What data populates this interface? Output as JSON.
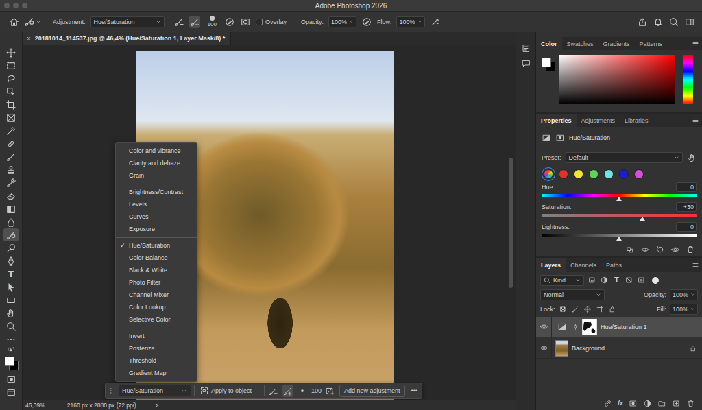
{
  "window": {
    "title": "Adobe Photoshop 2026"
  },
  "options_bar": {
    "adjustment_label": "Adjustment:",
    "adjustment": "Hue/Saturation",
    "brush_modes": [
      {
        "kind": "subtract",
        "selected": false
      },
      {
        "kind": "add",
        "selected": true
      }
    ],
    "brush_size": "100",
    "overlay": {
      "label": "Overlay",
      "checked": false
    },
    "opacity_label": "Opacity:",
    "opacity": "100%",
    "flow_label": "Flow:",
    "flow": "100%"
  },
  "document": {
    "tab": "20181014_114537.jpg @ 46,4% (Hue/Saturation 1, Layer Mask/8) *",
    "close": "×"
  },
  "tools": [
    {
      "kind": "move",
      "selected": false
    },
    {
      "kind": "marquee",
      "selected": false
    },
    {
      "kind": "lasso",
      "selected": false
    },
    {
      "kind": "object-select",
      "selected": false
    },
    {
      "kind": "crop",
      "selected": false
    },
    {
      "kind": "frame",
      "selected": false
    },
    {
      "kind": "eyedropper",
      "selected": false
    },
    {
      "kind": "healing",
      "selected": false
    },
    {
      "kind": "brush",
      "selected": false
    },
    {
      "kind": "stamp",
      "selected": false
    },
    {
      "kind": "history-brush",
      "selected": false
    },
    {
      "kind": "eraser",
      "selected": false
    },
    {
      "kind": "gradient",
      "selected": false
    },
    {
      "kind": "blur",
      "selected": false
    },
    {
      "kind": "adjustment-brush",
      "selected": true
    },
    {
      "kind": "dodge",
      "selected": false
    },
    {
      "kind": "pen",
      "selected": false
    },
    {
      "kind": "type",
      "glyph": "T",
      "selected": false
    },
    {
      "kind": "path-select",
      "selected": false
    },
    {
      "kind": "rectangle",
      "selected": false
    },
    {
      "kind": "hand",
      "selected": false
    },
    {
      "kind": "zoom",
      "selected": false
    },
    {
      "kind": "more",
      "selected": false
    }
  ],
  "adjustment_menu": {
    "check": "✓",
    "groups": [
      [
        {
          "label": "Color and vibrance",
          "selected": false
        },
        {
          "label": "Clarity and dehaze",
          "selected": false
        },
        {
          "label": "Grain",
          "selected": false
        }
      ],
      [
        {
          "label": "Brightness/Contrast",
          "selected": false
        },
        {
          "label": "Levels",
          "selected": false
        },
        {
          "label": "Curves",
          "selected": false
        },
        {
          "label": "Exposure",
          "selected": false
        }
      ],
      [
        {
          "label": "Hue/Saturation",
          "selected": true
        },
        {
          "label": "Color Balance",
          "selected": false
        },
        {
          "label": "Black & White",
          "selected": false
        },
        {
          "label": "Photo Filter",
          "selected": false
        },
        {
          "label": "Channel Mixer",
          "selected": false
        },
        {
          "label": "Color Lookup",
          "selected": false
        },
        {
          "label": "Selective Color",
          "selected": false
        }
      ],
      [
        {
          "label": "Invert",
          "selected": false
        },
        {
          "label": "Posterize",
          "selected": false
        },
        {
          "label": "Threshold",
          "selected": false
        },
        {
          "label": "Gradient Map",
          "selected": false
        }
      ]
    ]
  },
  "task_bar": {
    "adjustment": "Hue/Saturation",
    "apply": "Apply to object",
    "brush_modes": [
      {
        "kind": "subtract",
        "selected": false
      },
      {
        "kind": "add",
        "selected": true
      }
    ],
    "brush_size": "100",
    "add": "Add new adjustment",
    "more": "•••"
  },
  "status_bar": {
    "zoom": "46,39%",
    "info": "2160 px x 2880 px (72 ppi)",
    "arrow": ">"
  },
  "color_panel": {
    "tabs": [
      {
        "label": "Color",
        "selected": true
      },
      {
        "label": "Swatches",
        "selected": false
      },
      {
        "label": "Gradients",
        "selected": false
      },
      {
        "label": "Patterns",
        "selected": false
      }
    ]
  },
  "properties_panel": {
    "tabs": [
      {
        "label": "Properties",
        "selected": true
      },
      {
        "label": "Adjustments",
        "selected": false
      },
      {
        "label": "Libraries",
        "selected": false
      }
    ],
    "title": "Hue/Saturation",
    "preset_label": "Preset:",
    "preset": "Default",
    "channels": [
      {
        "kind": "master",
        "selected": true
      },
      {
        "kind": "channel",
        "selected": false,
        "color": "#e0312b"
      },
      {
        "kind": "channel",
        "selected": false,
        "color": "#f0e638"
      },
      {
        "kind": "channel",
        "selected": false,
        "color": "#5fd35a"
      },
      {
        "kind": "channel",
        "selected": false,
        "color": "#6fe3e3"
      },
      {
        "kind": "channel",
        "selected": false,
        "color": "#1c1fc9"
      },
      {
        "kind": "channel",
        "selected": false,
        "color": "#d64fd8"
      }
    ],
    "sliders": [
      {
        "label": "Hue:",
        "value": "0",
        "level": 0.5,
        "kind": "hue"
      },
      {
        "label": "Saturation:",
        "value": "+30",
        "level": 0.65,
        "kind": "saturation"
      },
      {
        "label": "Lightness:",
        "value": "0",
        "level": 0.5,
        "kind": "lightness"
      }
    ]
  },
  "layers_panel": {
    "tabs": [
      {
        "label": "Layers",
        "selected": true
      },
      {
        "label": "Channels",
        "selected": false
      },
      {
        "label": "Paths",
        "selected": false
      }
    ],
    "filter": "Kind",
    "filter_icons": [
      {
        "kind": "pixel"
      },
      {
        "kind": "adjust"
      },
      {
        "kind": "type",
        "glyph": "T"
      },
      {
        "kind": "shape"
      },
      {
        "kind": "smart"
      }
    ],
    "filter_toggle": {
      "on": true
    },
    "blend_mode": "Normal",
    "opacity_label": "Opacity:",
    "opacity": "100%",
    "lock_label": "Lock:",
    "fill_label": "Fill:",
    "fill": "100%",
    "layers": [
      {
        "name": "Hue/Saturation 1",
        "kind": "adjustment",
        "selected": true,
        "visible": true,
        "locked": false
      },
      {
        "name": "Background",
        "kind": "image",
        "selected": false,
        "visible": true,
        "locked": true
      }
    ],
    "footer_fx": "fx"
  }
}
